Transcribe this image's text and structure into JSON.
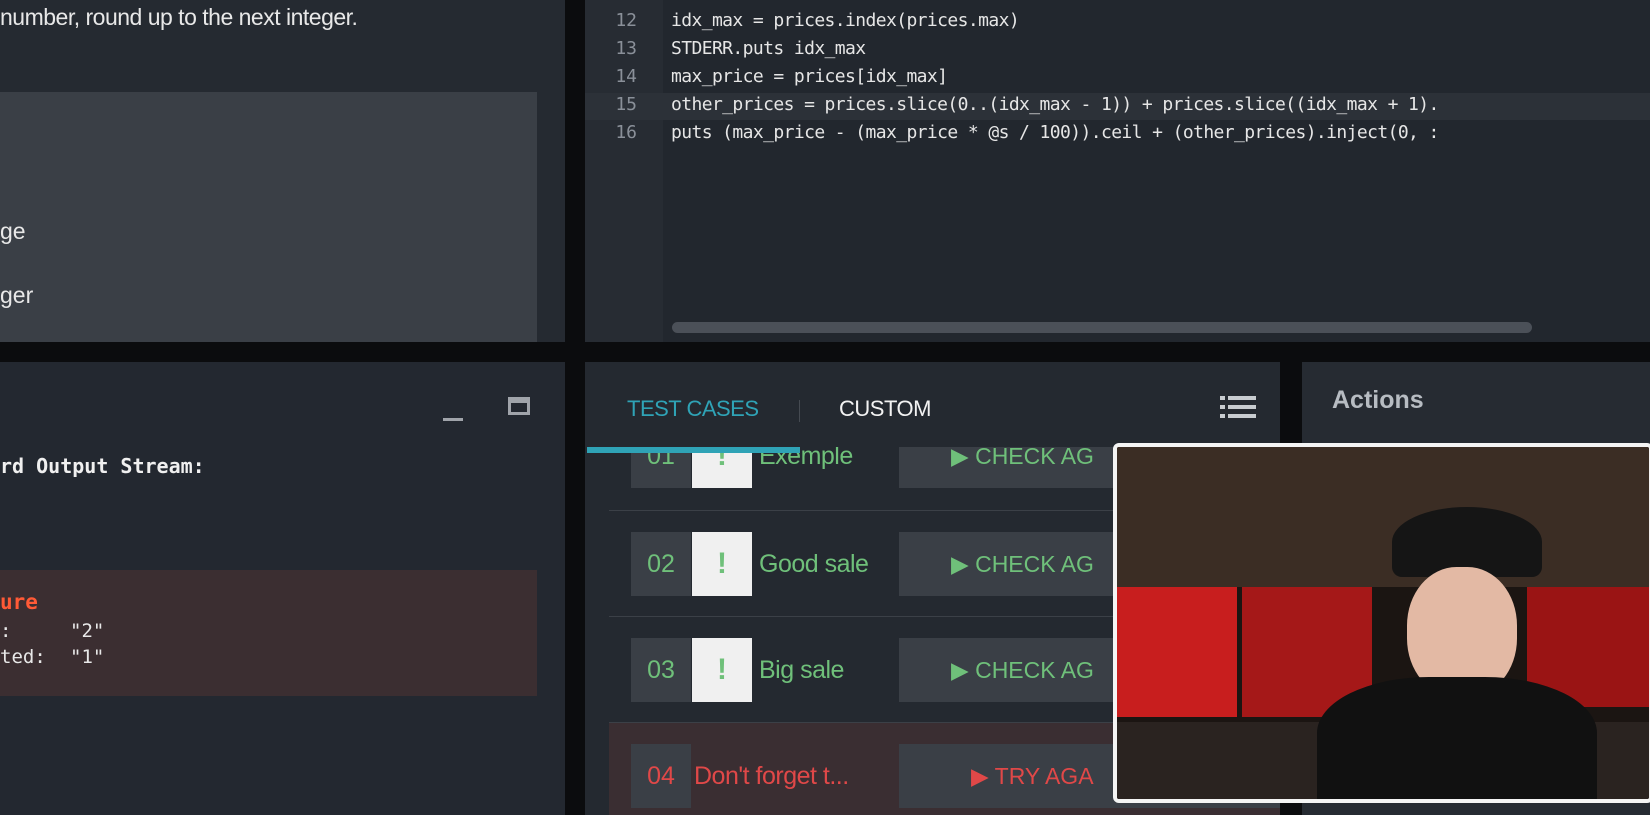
{
  "statement": {
    "text": "number, round up to the next integer.",
    "constraint_lines": [
      "ge",
      "ger"
    ]
  },
  "editor": {
    "lines": [
      {
        "n": "12",
        "code": "idx_max = prices.index(prices.max)"
      },
      {
        "n": "13",
        "code": "STDERR.puts idx_max"
      },
      {
        "n": "14",
        "code": "max_price = prices[idx_max]"
      },
      {
        "n": "15",
        "code": "other_prices = prices.slice(0..(idx_max - 1)) + prices.slice((idx_max + 1)."
      },
      {
        "n": "16",
        "code": "puts (max_price - (max_price * @s / 100)).ceil + (other_prices).inject(0, :"
      }
    ],
    "current_line": "15"
  },
  "console": {
    "header": "rd Output Stream:",
    "failure_title": "ure",
    "found_label": ":",
    "found_value": "\"2\"",
    "expected_label": "ted:",
    "expected_value": "\"1\""
  },
  "tests": {
    "tabs": [
      {
        "label": "TEST CASES",
        "active": true
      },
      {
        "label": "CUSTOM",
        "active": false
      }
    ],
    "rows": [
      {
        "num": "01",
        "name": "Exemple",
        "action": "CHECK AG",
        "status": "pass"
      },
      {
        "num": "02",
        "name": "Good sale",
        "action": "CHECK AG",
        "status": "pass"
      },
      {
        "num": "03",
        "name": "Big sale",
        "action": "CHECK AG",
        "status": "pass"
      },
      {
        "num": "04",
        "name": "Don't forget t...",
        "action": "TRY AGA",
        "status": "fail"
      }
    ],
    "badge": "!"
  },
  "actions": {
    "title": "Actions"
  },
  "colors": {
    "accent": "#2fa3b6",
    "pass": "#6fc07a",
    "fail": "#e04848",
    "failure_text": "#ff5a36"
  }
}
